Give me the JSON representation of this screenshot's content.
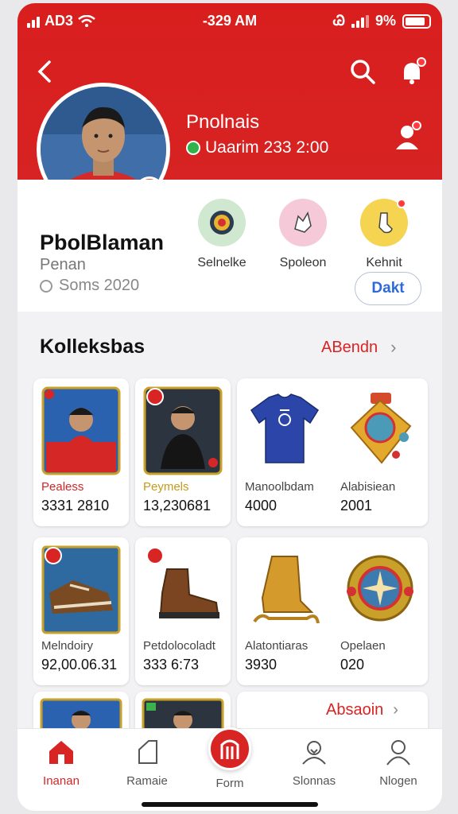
{
  "status_bar": {
    "carrier": "AD3",
    "time": "-329 AM",
    "indicator": "Ꮚ",
    "battery": "9%"
  },
  "hero": {
    "title": "Pnolnais",
    "subtitle": "Uaarim 233 2:00"
  },
  "profile": {
    "name": "PbolBlaman",
    "role": "Penan",
    "since": "Soms 2020"
  },
  "quick_actions": [
    {
      "label": "Selnelke",
      "icon": "soccer-ball-icon",
      "color": "#cfe8cf"
    },
    {
      "label": "Spoleon",
      "icon": "splash-icon",
      "color": "#f5c9d8"
    },
    {
      "label": "Kehnit",
      "icon": "sock-icon",
      "color": "#f4d451"
    }
  ],
  "dakt_button": "Dakt",
  "collection": {
    "title": "Kolleksbas",
    "link": "ABendn",
    "items_row1": [
      {
        "name": "Pealess",
        "price": "3331 2810",
        "icon": "player-card-red-icon",
        "name_style": "red"
      },
      {
        "name": "Peymels",
        "price": "13,230681",
        "icon": "player-card-black-icon",
        "name_style": "gold"
      },
      {
        "name": "Manoolbdam",
        "price": "4000",
        "icon": "jersey-icon",
        "name_style": ""
      },
      {
        "name": "Alabisiean",
        "price": "2001",
        "icon": "medal-icon",
        "name_style": ""
      }
    ],
    "items_row2": [
      {
        "name": "Melndoiry",
        "price": "92,00.06.31",
        "icon": "boot-card-icon",
        "name_style": ""
      },
      {
        "name": "Petdolocoladt",
        "price": "333 6:73",
        "icon": "brown-boot-icon",
        "name_style": ""
      },
      {
        "name": "Alatontiaras",
        "price": "3930",
        "icon": "golden-boot-icon",
        "name_style": ""
      },
      {
        "name": "Opelaen",
        "price": "020",
        "icon": "badge-icon",
        "name_style": ""
      }
    ],
    "more_link": "Absaoin"
  },
  "bottom_nav": [
    {
      "label": "Inanan",
      "icon": "home-icon",
      "active": true
    },
    {
      "label": "Ramaie",
      "icon": "tag-icon",
      "active": false
    },
    {
      "label": "Form",
      "icon": "center-add-icon",
      "active": false
    },
    {
      "label": "Slonnas",
      "icon": "profile-heart-icon",
      "active": false
    },
    {
      "label": "Nlogen",
      "icon": "user-icon",
      "active": false
    }
  ],
  "colors": {
    "brand_red": "#d92424",
    "link_blue": "#2d6ad8"
  }
}
